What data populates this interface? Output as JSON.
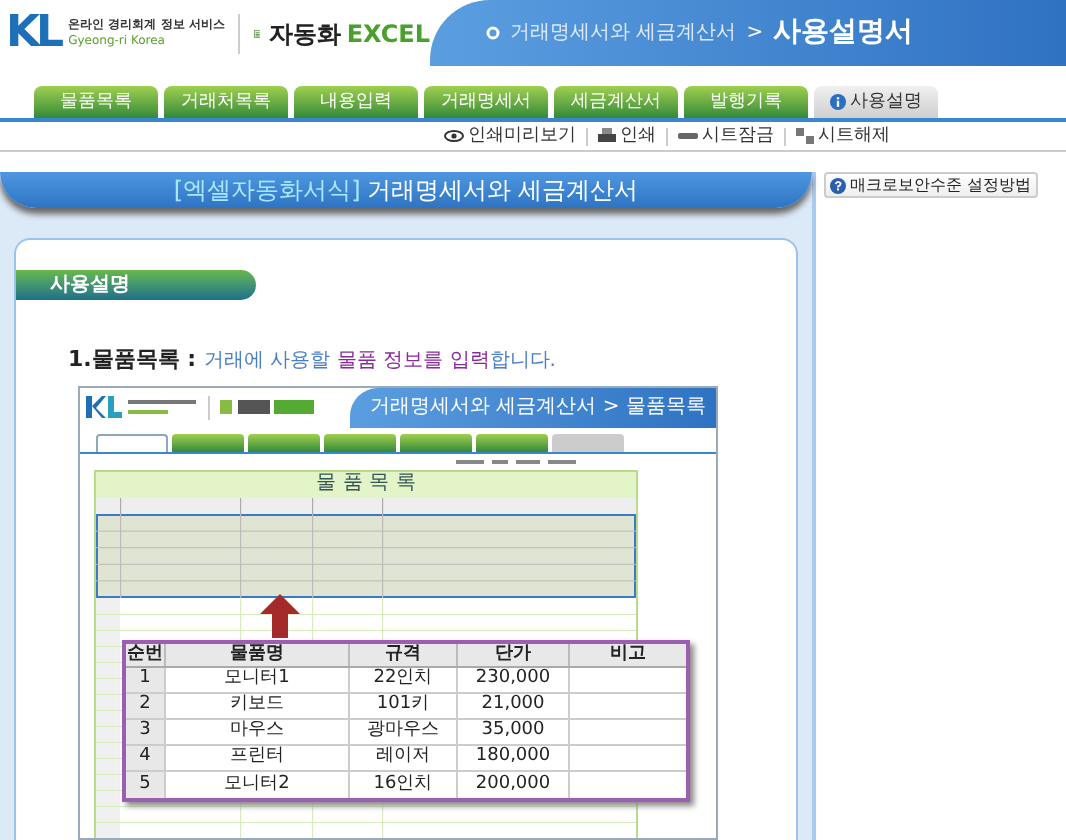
{
  "header": {
    "logo": "KL",
    "service_name": "온라인 경리회계 정보 서비스",
    "service_sub": "Gyeong-ri Korea",
    "product_name": "자동화",
    "product_excel": "EXCEL",
    "breadcrumb_section": "거래명세서와 세금계산서",
    "breadcrumb_separator": ">",
    "breadcrumb_page": "사용설명서"
  },
  "tabs": [
    {
      "label": "물품목록",
      "selected": false
    },
    {
      "label": "거래처목록",
      "selected": false
    },
    {
      "label": "내용입력",
      "selected": false
    },
    {
      "label": "거래명세서",
      "selected": false
    },
    {
      "label": "세금계산서",
      "selected": false
    },
    {
      "label": "발행기록",
      "selected": false
    },
    {
      "label": "사용설명",
      "selected": true
    }
  ],
  "toolbar": [
    {
      "kind": "preview",
      "label": "인쇄미리보기"
    },
    {
      "kind": "print",
      "label": "인쇄"
    },
    {
      "kind": "lock",
      "label": "시트잠금"
    },
    {
      "kind": "unlock",
      "label": "시트해제"
    }
  ],
  "banner": {
    "prefix": "[엑셀자동화서식]",
    "title": "거래명세서와 세금계산서"
  },
  "side_button": "매크로보안수준 설정방법",
  "section_title": "사용설명",
  "step": {
    "label": "1.물품목록 :",
    "description": "거래에 사용할 **물품 정보를 입력**합니다."
  },
  "example": {
    "breadcrumb": "거래명세서와 세금계산서 > 물품목록",
    "sheet_title": "물 품 목 록",
    "tabs": [
      {
        "selected": true
      },
      {
        "selected": false
      },
      {
        "selected": false
      },
      {
        "selected": false
      },
      {
        "selected": false
      },
      {
        "selected": false
      },
      {
        "selected": false
      }
    ]
  },
  "callout_table": {
    "columns": [
      "순번",
      "물품명",
      "규격",
      "단가",
      "비고"
    ],
    "rows": [
      [
        "1",
        "모니터1",
        "22인치",
        "230,000",
        ""
      ],
      [
        "2",
        "키보드",
        "101키",
        "21,000",
        ""
      ],
      [
        "3",
        "마우스",
        "광마우스",
        "35,000",
        ""
      ],
      [
        "4",
        "프린터",
        "레이저",
        "180,000",
        ""
      ],
      [
        "5",
        "모니터2",
        "16인치",
        "200,000",
        ""
      ]
    ]
  }
}
